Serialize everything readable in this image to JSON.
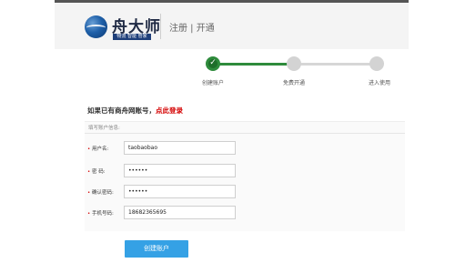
{
  "header": {
    "logo_name": "舟大师",
    "logo_tagline": "物流 智能 管家",
    "title": "注册 | 开通"
  },
  "steps": [
    {
      "label": "创建账户",
      "state": "done"
    },
    {
      "label": "免费开通",
      "state": "todo"
    },
    {
      "label": "进入使用",
      "state": "todo"
    }
  ],
  "notice": {
    "text": "如果已有商舟网账号，",
    "link": "点此登录"
  },
  "form": {
    "heading": "填写账户信息:",
    "fields": [
      {
        "label": "用户名:",
        "required": true,
        "value": "taobaobao"
      },
      {
        "label": "密 码:",
        "required": true,
        "value": "••••••"
      },
      {
        "label": "确认密码:",
        "required": true,
        "value": "••••••"
      },
      {
        "label": "手机号码:",
        "required": true,
        "value": "18682365695"
      }
    ],
    "submit_label": "创建账户"
  },
  "colors": {
    "accent_green": "#2e8b3c",
    "link_red": "#d40000",
    "button_blue": "#35a1e5"
  }
}
